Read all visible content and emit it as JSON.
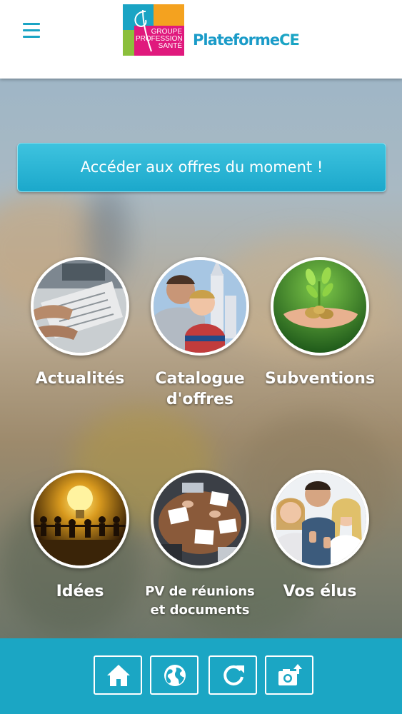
{
  "header": {
    "menu_icon": "hamburger-menu-icon",
    "logo": {
      "lines": [
        "GROUPE",
        "PROFESSION",
        "SANTÉ"
      ],
      "colors": [
        "#8bbf3b",
        "#f4a21f",
        "#e0197d",
        "#1aa4c4"
      ]
    },
    "brand": {
      "part1": "Plateforme",
      "part2": "CE"
    }
  },
  "cta": {
    "label": "Accéder aux offres du moment !"
  },
  "tiles": [
    {
      "label": "Actualités",
      "icon": "newspaper-photo"
    },
    {
      "label": "Catalogue d'offres",
      "line1": "Catalogue",
      "line2": "d'offres",
      "icon": "family-photo"
    },
    {
      "label": "Subventions",
      "icon": "plant-coins-photo"
    },
    {
      "label": "Idées",
      "icon": "lightbulb-photo"
    },
    {
      "label": "PV de réunions et documents",
      "line1": "PV de réunions",
      "line2": "et documents",
      "icon": "meeting-photo"
    },
    {
      "label": "Vos élus",
      "icon": "people-thumbs-up-photo"
    }
  ],
  "bottom_bar": {
    "icons": [
      "home-icon",
      "globe-icon",
      "refresh-icon",
      "camera-upload-icon"
    ],
    "color": "#1ba6c4"
  }
}
